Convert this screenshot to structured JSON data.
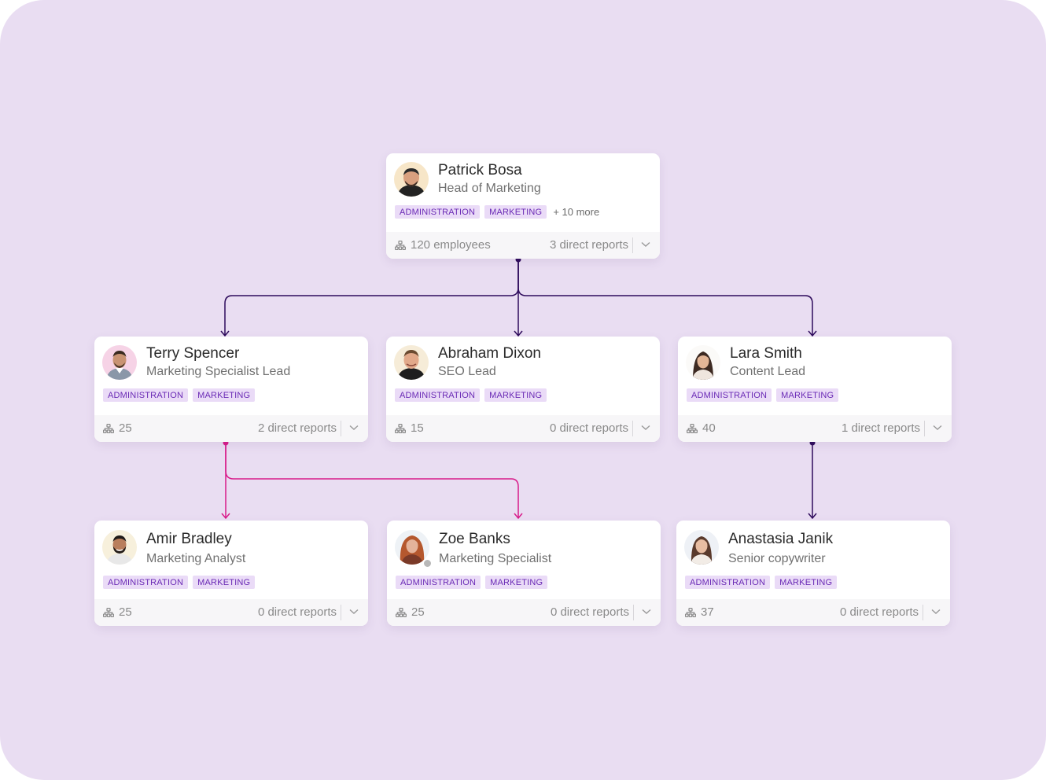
{
  "colors": {
    "background": "#e9ddf2",
    "tag_bg": "#eadbf7",
    "tag_text": "#6a2ab5",
    "line_dark": "#2e0b5c",
    "line_pink": "#d81b8a"
  },
  "icons": {
    "team": "org-chart-icon",
    "expand": "chevron-down-icon"
  },
  "employees": {
    "patrick": {
      "name": "Patrick Bosa",
      "role": "Head of Marketing",
      "tags": [
        "ADMINISTRATION",
        "MARKETING"
      ],
      "more": "+ 10 more",
      "employees": "120 employees",
      "reports": "3 direct reports"
    },
    "terry": {
      "name": "Terry Spencer",
      "role": "Marketing Specialist Lead",
      "tags": [
        "ADMINISTRATION",
        "MARKETING"
      ],
      "employees": "25",
      "reports": "2 direct reports"
    },
    "abraham": {
      "name": "Abraham Dixon",
      "role": "SEO Lead",
      "tags": [
        "ADMINISTRATION",
        "MARKETING"
      ],
      "employees": "15",
      "reports": "0 direct reports"
    },
    "lara": {
      "name": "Lara Smith",
      "role": "Content Lead",
      "tags": [
        "ADMINISTRATION",
        "MARKETING"
      ],
      "employees": "40",
      "reports": "1 direct reports"
    },
    "amir": {
      "name": "Amir Bradley",
      "role": "Marketing Analyst",
      "tags": [
        "ADMINISTRATION",
        "MARKETING"
      ],
      "employees": "25",
      "reports": "0 direct reports"
    },
    "zoe": {
      "name": "Zoe Banks",
      "role": "Marketing Specialist",
      "tags": [
        "ADMINISTRATION",
        "MARKETING"
      ],
      "employees": "25",
      "reports": "0 direct reports"
    },
    "anastasia": {
      "name": "Anastasia Janik",
      "role": "Senior copywriter",
      "tags": [
        "ADMINISTRATION",
        "MARKETING"
      ],
      "employees": "37",
      "reports": "0 direct reports"
    }
  }
}
